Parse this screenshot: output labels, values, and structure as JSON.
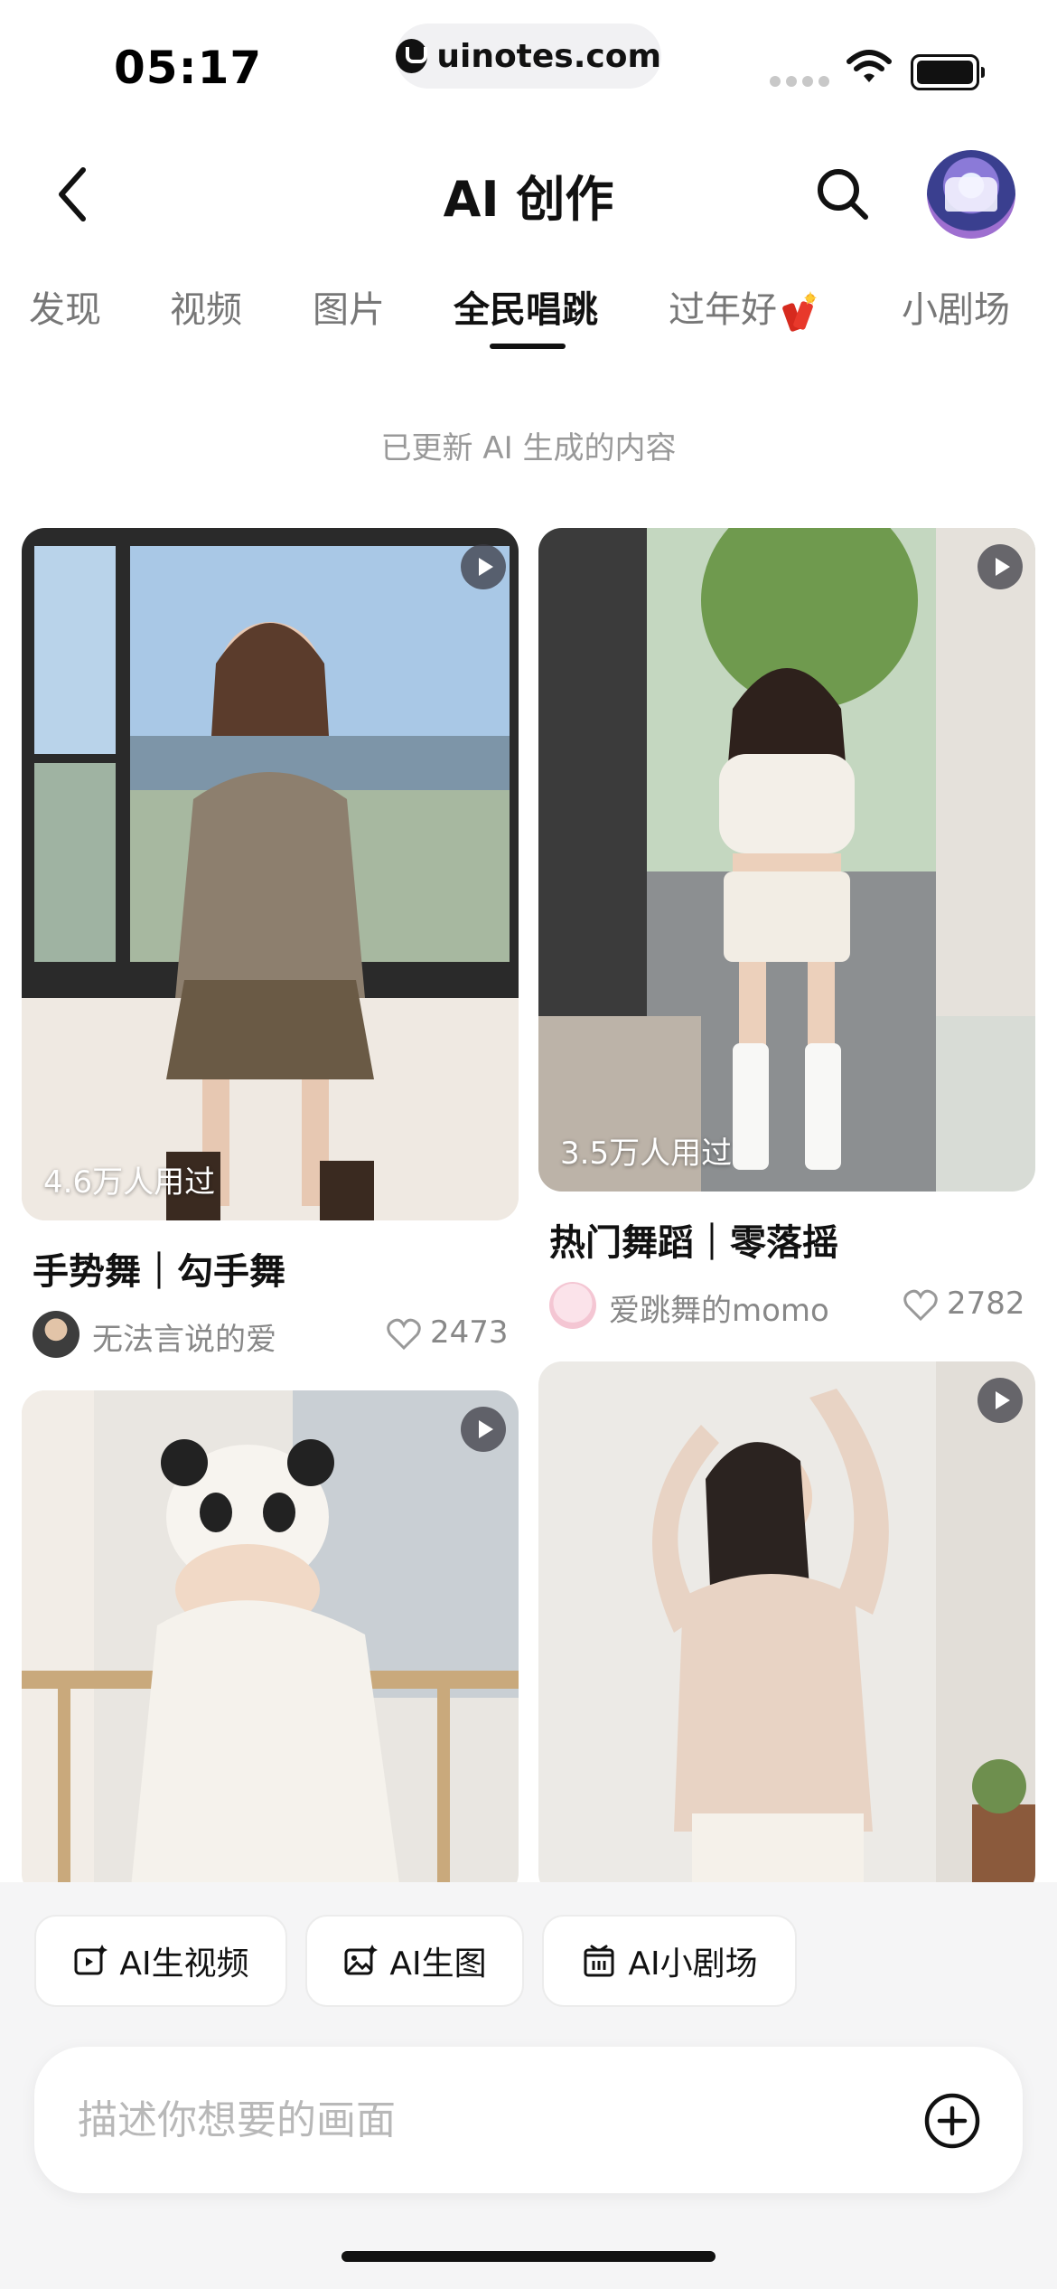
{
  "status_bar": {
    "time": "05:17",
    "url": "uinotes.com"
  },
  "header": {
    "title": "AI 创作"
  },
  "tabs": [
    {
      "label": "发现",
      "active": false
    },
    {
      "label": "视频",
      "active": false
    },
    {
      "label": "图片",
      "active": false
    },
    {
      "label": "全民唱跳",
      "active": true
    },
    {
      "label": "过年好",
      "icon": "firecracker-icon",
      "active": false
    },
    {
      "label": "小剧场",
      "active": false
    }
  ],
  "update_note": "已更新 AI 生成的内容",
  "feed": [
    {
      "usage": "4.6万人用过",
      "title": "手势舞｜勾手舞",
      "author": "无法言说的爱",
      "likes": "2473"
    },
    {
      "usage": "3.5万人用过",
      "title": "热门舞蹈｜零落摇",
      "author": "爱跳舞的momo",
      "likes": "2782"
    },
    {
      "usage": "",
      "title": "",
      "author": "",
      "likes": ""
    },
    {
      "usage": "",
      "title": "",
      "author": "",
      "likes": ""
    }
  ],
  "quick_actions": [
    {
      "label": "AI生视频",
      "icon": "video-sparkle-icon"
    },
    {
      "label": "AI生图",
      "icon": "image-sparkle-icon"
    },
    {
      "label": "AI小剧场",
      "icon": "theater-icon"
    }
  ],
  "prompt": {
    "placeholder": "描述你想要的画面",
    "value": ""
  },
  "colors": {
    "accent": "#111111",
    "muted": "#888888",
    "panel": "#f5f5f6"
  }
}
